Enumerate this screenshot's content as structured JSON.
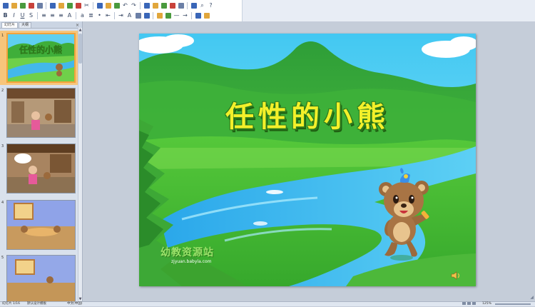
{
  "toolbar": {
    "row1": [
      "new-icon",
      "open-icon",
      "save-icon",
      "permission-icon",
      "email-icon",
      "print-icon",
      "print-preview-icon",
      "spelling-icon",
      "research-icon",
      "cut-icon",
      "copy-icon",
      "paste-icon",
      "format-painter-icon",
      "undo-icon",
      "redo-icon",
      "insert-chart-icon",
      "insert-table-icon",
      "insert-picture-icon",
      "insert-wordart-icon",
      "new-slide-icon",
      "color-grayscale-icon",
      "zoom-icon",
      "help-icon"
    ],
    "row2": [
      "bold-icon",
      "italic-icon",
      "underline-icon",
      "shadow-icon",
      "align-left-icon",
      "center-icon",
      "align-right-icon",
      "font-grow-icon",
      "font-shrink-icon",
      "numbering-icon",
      "bullets-icon",
      "decrease-indent-icon",
      "increase-indent-icon",
      "font-color-icon",
      "design-icon",
      "new-slide-2-icon",
      "fill-color-icon",
      "line-color-icon",
      "line-style-icon",
      "arrow-style-icon",
      "shadow-style-icon",
      "3d-style-icon"
    ],
    "colors": [
      "#3a66b8",
      "#e1a63b",
      "#4a9a3e",
      "#c8423b",
      "#6b7fa6"
    ]
  },
  "panel": {
    "tabs": [
      "幻灯片",
      "大纲"
    ],
    "close": "×",
    "slides": [
      {
        "num": "1",
        "selected": true
      },
      {
        "num": "2",
        "selected": false
      },
      {
        "num": "3",
        "selected": false
      },
      {
        "num": "4",
        "selected": false
      },
      {
        "num": "5",
        "selected": false
      }
    ]
  },
  "slide": {
    "title": "任性的小熊",
    "watermark_logo": "幼教资源站",
    "watermark_url": "zjyuan.babyla.com"
  },
  "status": {
    "slide_info": "幻灯片 1/16",
    "theme": "默认设计模板",
    "language": "中文(中国)",
    "zoom": "125%"
  }
}
